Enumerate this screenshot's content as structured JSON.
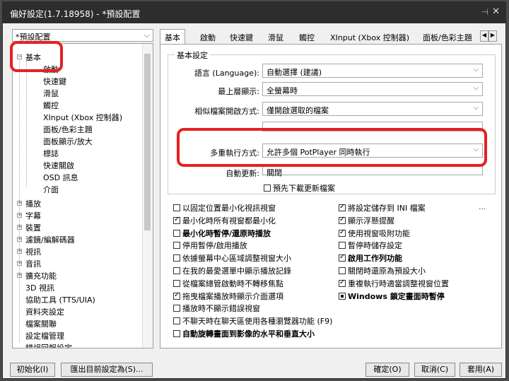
{
  "window": {
    "title": "偏好設定(1.7.18958) - *預設配置",
    "pin": "⊣",
    "close": "✕"
  },
  "preset": {
    "value": "*預設配置"
  },
  "tree": {
    "items": [
      "基本",
      "啟動",
      "快速鍵",
      "滑鼠",
      "觸控",
      "XInput (Xbox 控制器)",
      "面板/色彩主題",
      "面板顯示/放大",
      "標誌",
      "快速關啟",
      "OSD 訊息",
      "介面",
      "播放",
      "字幕",
      "裝置",
      "濾鏡/編解碼器",
      "視訊",
      "音訊",
      "擴充功能",
      "3D 視訊",
      "協助工具 (TTS/UIA)",
      "資料夾設定",
      "檔案關聯",
      "設定檔管理",
      "錯誤回報設定"
    ]
  },
  "tabs": [
    "基本",
    "啟動",
    "快速鍵",
    "滑鼠",
    "觸控",
    "XInput (Xbox 控制器)",
    "面板/色彩主題"
  ],
  "basic": {
    "group_title": "基本設定",
    "rows": [
      {
        "label": "語言 (Language):",
        "value": "自動選擇 (建議)"
      },
      {
        "label": "最上層顯示:",
        "value": "全螢幕時"
      },
      {
        "label": "相似檔案開啟方式:",
        "value": "僅開啟選取的檔案"
      },
      {
        "label": "",
        "value": ""
      },
      {
        "label": "多重執行方式:",
        "value": "允許多個 PotPlayer 同時執行"
      },
      {
        "label": "自動更新:",
        "value": "關閉"
      }
    ],
    "predownload": "預先下載更新檔案"
  },
  "options_left": [
    {
      "text": "以固定位置最小化視訊視窗",
      "state": "off",
      "bold": false
    },
    {
      "text": "最小化時所有視窗都最小化",
      "state": "on",
      "bold": false
    },
    {
      "text": "最小化時暫停/還原時播放",
      "state": "off",
      "bold": true
    },
    {
      "text": "停用暫停/啟用播放",
      "state": "off",
      "bold": false
    },
    {
      "text": "依據螢幕中心區域調整視窗大小",
      "state": "off",
      "bold": false
    },
    {
      "text": "在我的最愛選單中顯示播放記錄",
      "state": "off",
      "bold": false
    },
    {
      "text": "從檔案總管啟動時不轉移焦點",
      "state": "off",
      "bold": false
    },
    {
      "text": "拖曳檔案播放時顯示介面選項",
      "state": "on",
      "bold": false
    },
    {
      "text": "播放時不顯示錯誤視窗",
      "state": "off",
      "bold": false
    },
    {
      "text": "不聊天時在聊天區使用各種瀏覽器功能 (F9)",
      "state": "off",
      "bold": false
    },
    {
      "text": "自動旋轉畫面到影像的水平和垂直大小",
      "state": "off",
      "bold": true
    }
  ],
  "options_right": [
    {
      "text": "將設定儲存到 INI 檔案",
      "state": "on",
      "bold": false
    },
    {
      "text": "顯示浮懸提醒",
      "state": "on",
      "bold": false
    },
    {
      "text": "使用視窗吸附功能",
      "state": "on",
      "bold": false
    },
    {
      "text": "暫停時儲存設定",
      "state": "off",
      "bold": false
    },
    {
      "text": "啟用工作列功能",
      "state": "on",
      "bold": true
    },
    {
      "text": "關閉時還原為預設大小",
      "state": "off",
      "bold": false
    },
    {
      "text": "重複執行時適當調整視窗位置",
      "state": "on",
      "bold": false
    },
    {
      "text": "Windows 鎖定畫面時暫停",
      "state": "partial",
      "bold": true
    }
  ],
  "more_link": "...",
  "buttons": {
    "init": "初始化(I)",
    "export": "匯出目前設定為(S)...",
    "ok": "確定(O)",
    "cancel": "取消(C)",
    "apply": "套用(A)"
  },
  "highlight_color": "#e62020"
}
